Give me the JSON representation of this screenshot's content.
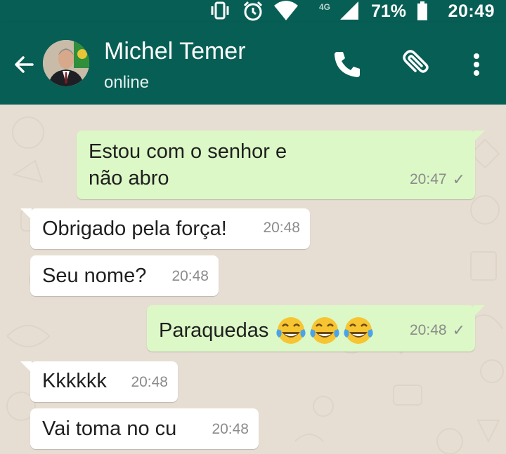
{
  "status_bar": {
    "network": "4G",
    "battery_percent": "71%",
    "time": "20:49",
    "icons": [
      "vibrate-icon",
      "alarm-icon",
      "wifi-icon",
      "signal-icon",
      "battery-icon"
    ]
  },
  "header": {
    "contact_name": "Michel Temer",
    "status": "online",
    "icons": [
      "back-arrow-icon",
      "call-icon",
      "attach-clip-icon",
      "overflow-menu-icon"
    ]
  },
  "messages": [
    {
      "direction": "out",
      "lines": [
        "Estou com o senhor e",
        "não abro"
      ],
      "time": "20:47",
      "status": "sent-check"
    },
    {
      "direction": "in",
      "text": "Obrigado pela força!",
      "time": "20:48"
    },
    {
      "direction": "in",
      "text": "Seu nome?",
      "time": "20:48"
    },
    {
      "direction": "out",
      "text": "Paraquedas",
      "emojis": [
        "tears-of-joy-emoji",
        "tears-of-joy-emoji",
        "tears-of-joy-emoji"
      ],
      "time": "20:48",
      "status": "sent-check"
    },
    {
      "direction": "in",
      "text": "Kkkkkk",
      "time": "20:48"
    },
    {
      "direction": "in",
      "text": "Vai toma no cu",
      "time": "20:48"
    }
  ],
  "colors": {
    "header": "#075e54",
    "outgoing_bubble": "#dcf8c6",
    "incoming_bubble": "#ffffff",
    "chat_background": "#e7ded3"
  }
}
